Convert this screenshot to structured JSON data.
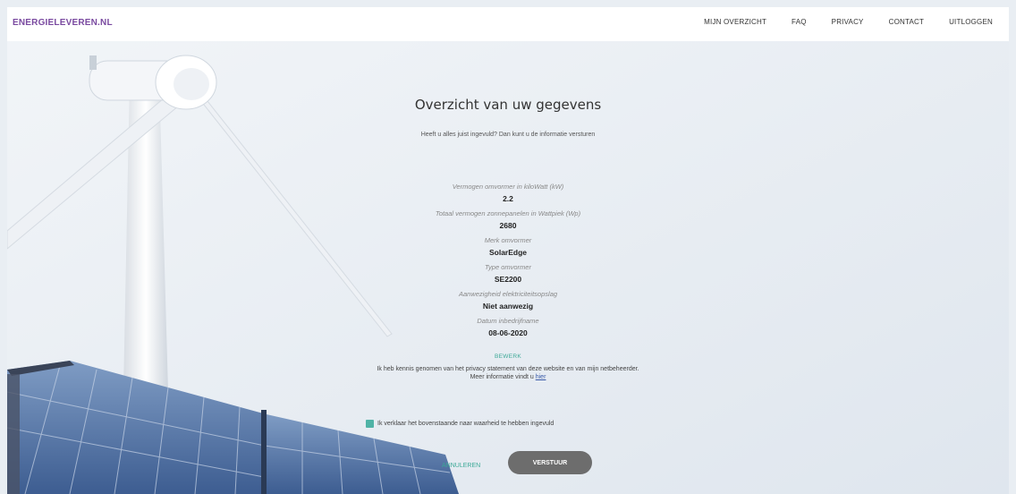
{
  "nav": {
    "logo": "ENERGIELEVEREN.NL",
    "items": [
      "MIJN OVERZICHT",
      "FAQ",
      "PRIVACY",
      "CONTACT",
      "UITLOGGEN"
    ]
  },
  "content": {
    "title": "Overzicht van uw gegevens",
    "subtitle": "Heeft u alles juist ingevuld? Dan kunt u de informatie versturen",
    "fields": [
      {
        "label": "Vermogen omvormer in kiloWatt (kW)",
        "value": "2.2"
      },
      {
        "label": "Totaal vermogen zonnepanelen in Wattpiek (Wp)",
        "value": "2680"
      },
      {
        "label": "Merk omvormer",
        "value": "SolarEdge"
      },
      {
        "label": "Type omvormer",
        "value": "SE2200"
      },
      {
        "label": "Aanwezigheid elektriciteitsopslag",
        "value": "Niet aanwezig"
      },
      {
        "label": "Datum inbedrijfname",
        "value": "08-06-2020"
      }
    ],
    "edit_label": "BEWERK",
    "privacy_text": "Ik heb kennis genomen van het privacy statement van deze website en van mijn netbeheerder. Meer informatie vindt u ",
    "privacy_link": "hier",
    "checkbox_label": "Ik verklaar het bovenstaande naar waarheid te hebben ingevuld",
    "cancel_label": "ANNULEREN",
    "submit_label": "VERSTUUR"
  },
  "colors": {
    "logo": "#7a4aa0",
    "accent": "#4fb3a6",
    "submit_bg": "#6d6d6d"
  }
}
